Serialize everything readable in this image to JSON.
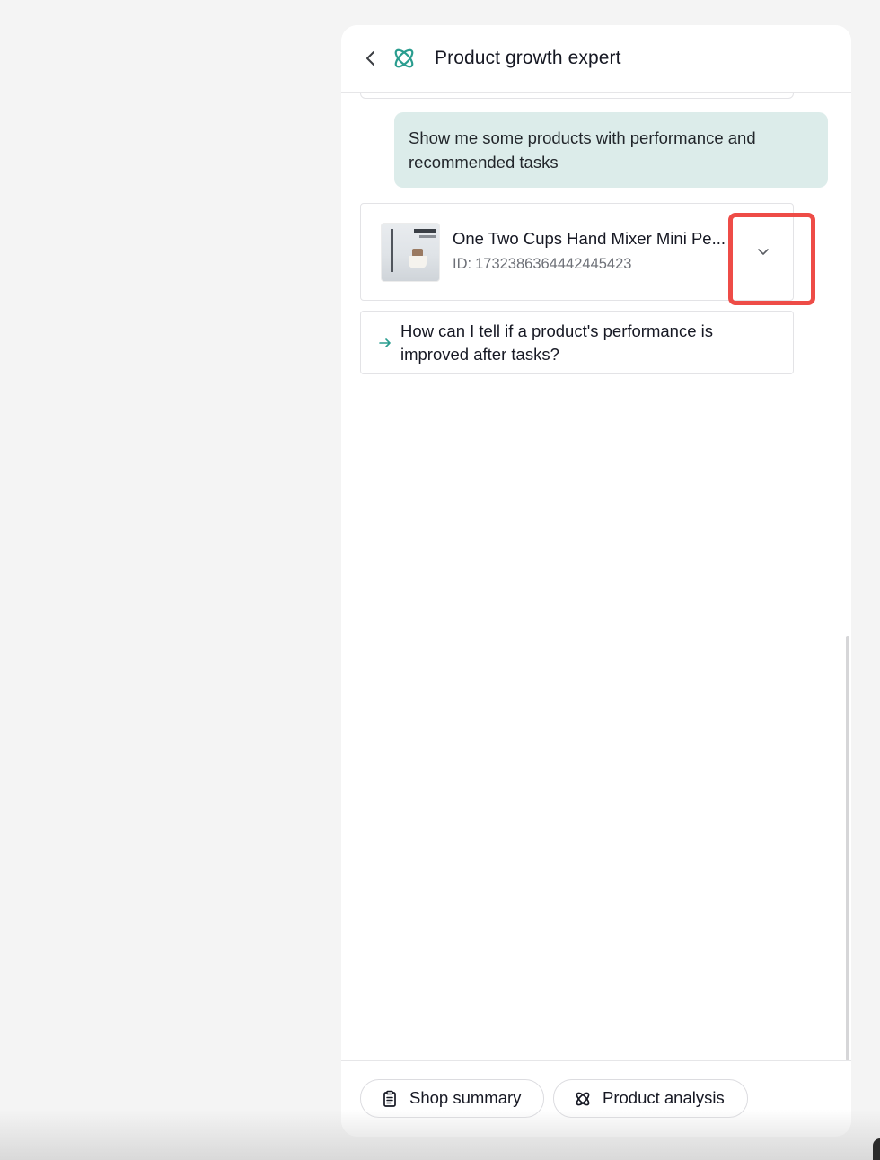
{
  "header": {
    "title": "Product growth expert"
  },
  "conversation": {
    "user_message": "Show me some products with performance and recommended tasks",
    "product_card": {
      "name": "One Two Cups Hand Mixer Mini Pe...",
      "id_label": "ID:",
      "id_value": "1732386364442445423"
    },
    "suggestion": "How can I tell if a product's performance is improved after tasks?"
  },
  "footer": {
    "chips": [
      {
        "label": "Shop summary",
        "icon": "clipboard-icon"
      },
      {
        "label": "Product analysis",
        "icon": "atom-icon"
      }
    ]
  },
  "colors": {
    "accent": "#2a9d8f",
    "user_bubble": "#dcecea",
    "highlight": "#ee4c47"
  }
}
